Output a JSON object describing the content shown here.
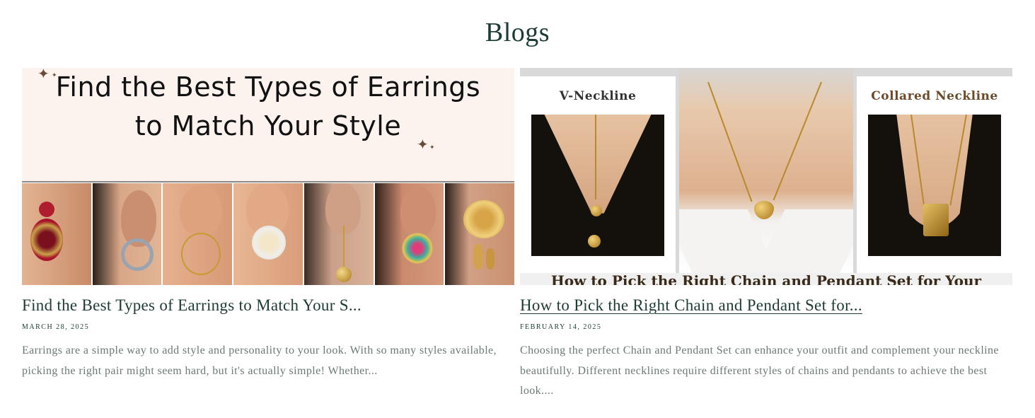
{
  "section": {
    "title": "Blogs"
  },
  "posts": [
    {
      "thumbnail": {
        "headline_line1": "Find the Best Types of Earrings",
        "headline_line2": "to Match Your Style"
      },
      "title": "Find the Best Types of Earrings to Match Your S...",
      "date": "MARCH 28, 2025",
      "excerpt": "Earrings are a simple way to add style and personality to your look. With so many styles available, picking the right pair might seem hard, but it's actually simple! Whether..."
    },
    {
      "thumbnail": {
        "label_left": "V-Neckline",
        "label_right": "Collared Neckline",
        "caption": "How to Pick the Right Chain and Pendant Set for Your Neckline"
      },
      "title": "How to Pick the Right Chain and Pendant Set for...",
      "date": "FEBRUARY 14, 2025",
      "excerpt": "Choosing the perfect Chain and Pendant Set can enhance your outfit and complement your neckline beautifully. Different necklines require different styles of chains and pendants to achieve the best look...."
    }
  ],
  "icons": {
    "sparkle": "sparkle-icon"
  },
  "colors": {
    "heading": "#1c3b34",
    "body": "#6b7a76",
    "banner_bg": "#fcf3ef"
  }
}
